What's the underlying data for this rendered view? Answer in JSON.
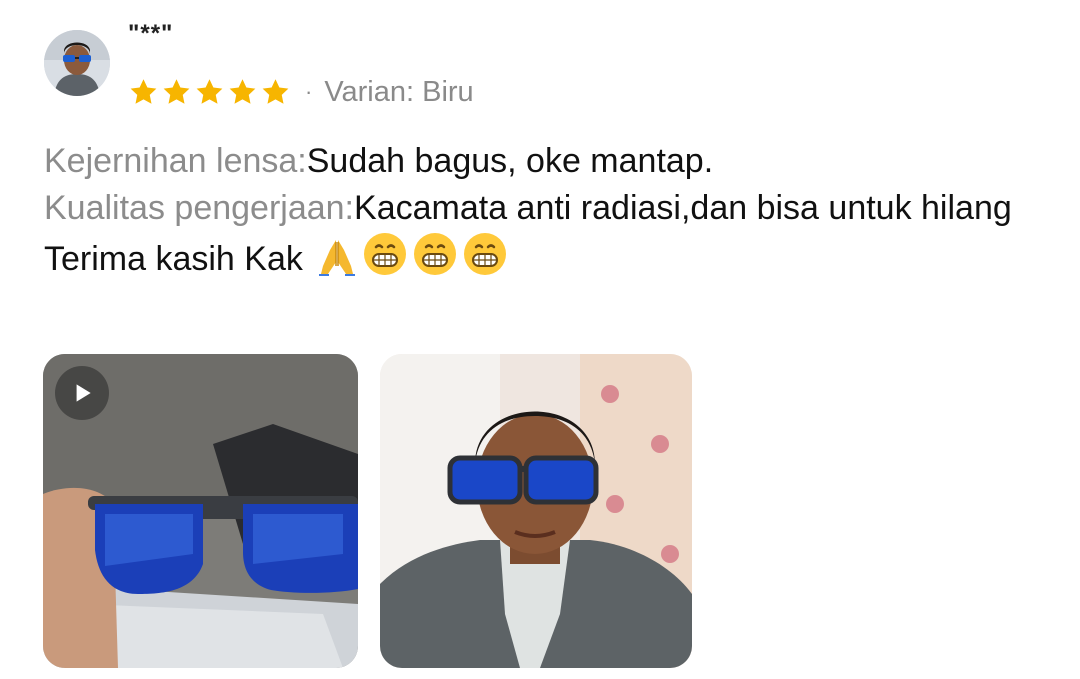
{
  "review": {
    "username": "\"**\"",
    "rating": 5,
    "rating_max": 5,
    "separator": "·",
    "variant": "Varian: Biru",
    "lines": [
      {
        "label": "Kejernihan lensa:",
        "text": "Sudah bagus, oke mantap."
      },
      {
        "label": "Kualitas pengerjaan:",
        "text": "Kacamata anti radiasi,dan bisa untuk hilang"
      }
    ],
    "closing": "Terima kasih Kak",
    "closing_emojis": [
      "folded-hands-icon",
      "grinning-face-icon",
      "grinning-face-icon",
      "grinning-face-icon"
    ],
    "media": [
      {
        "type": "video",
        "icon": "play-icon"
      },
      {
        "type": "photo"
      }
    ]
  },
  "colors": {
    "star": "#F7B500",
    "label": "#8c8c8c",
    "text": "#111111"
  }
}
